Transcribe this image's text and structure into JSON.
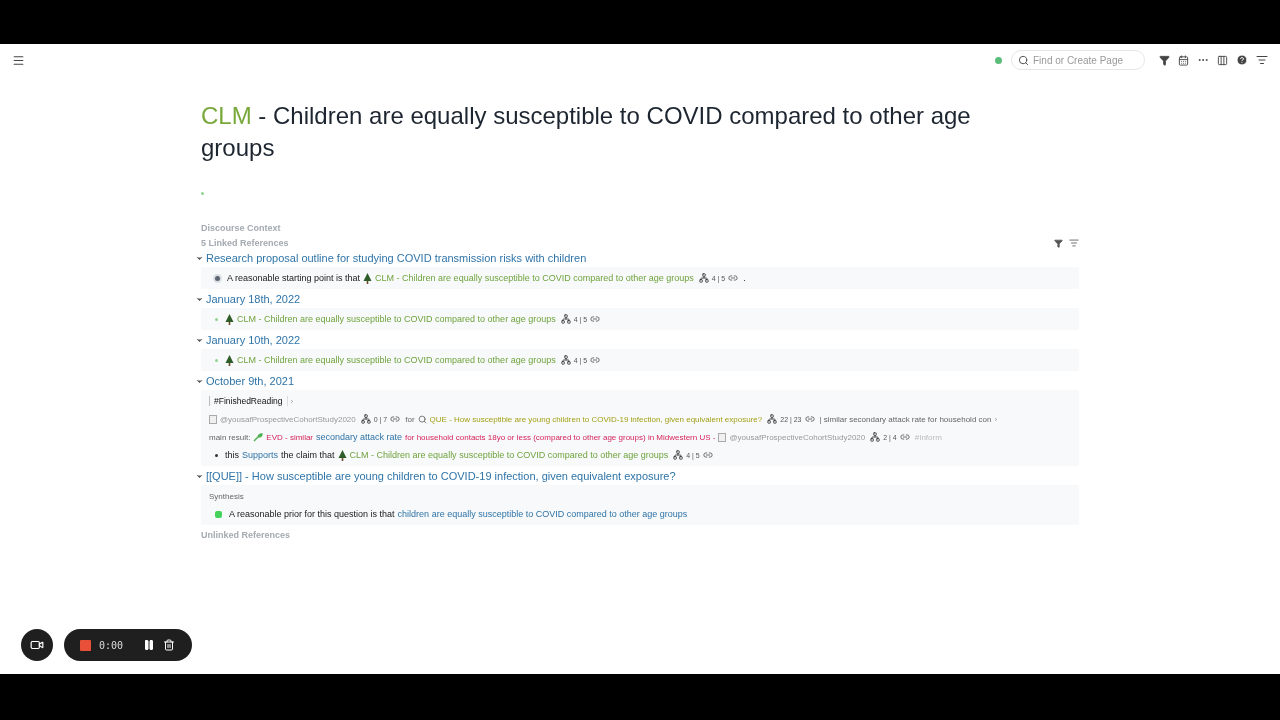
{
  "topbar": {
    "synced": true,
    "search": {
      "placeholder": "Find or Create Page"
    }
  },
  "title": {
    "prefix": "CLM",
    "rest": " - Children are equally susceptible to COVID compared to other age groups"
  },
  "discourse_context": "Discourse Context",
  "linked_references": {
    "label": "5 Linked References",
    "groups": [
      {
        "title": "Research proposal outline for studying COVID transmission risks with children",
        "expanded": true,
        "blocks": [
          {
            "kind": "ring",
            "parts": [
              {
                "kind": "text",
                "text": "A reasonable starting point is that"
              },
              {
                "kind": "claim",
                "text": "CLM - Children are equally susceptible to COVID compared to other age groups"
              },
              {
                "kind": "counts",
                "text": "4 | 5"
              },
              {
                "kind": "text",
                "text": "."
              }
            ]
          }
        ]
      },
      {
        "title": "January 18th, 2022",
        "expanded": true,
        "blocks": [
          {
            "kind": "dot",
            "parts": [
              {
                "kind": "claim",
                "text": "CLM - Children are equally susceptible to COVID compared to other age groups"
              },
              {
                "kind": "counts",
                "text": "4 | 5"
              }
            ]
          }
        ]
      },
      {
        "title": "January 10th, 2022",
        "expanded": true,
        "blocks": [
          {
            "kind": "dot",
            "parts": [
              {
                "kind": "claim",
                "text": "CLM - Children are equally susceptible to COVID compared to other age groups"
              },
              {
                "kind": "counts",
                "text": "4 | 5"
              }
            ]
          }
        ]
      },
      {
        "title": "October 9th, 2021",
        "expanded": true,
        "blocks": [
          {
            "kind": "none",
            "parts": [
              {
                "kind": "tag",
                "text": "#FinishedReading"
              },
              {
                "kind": "chevron",
                "text": "›"
              }
            ]
          },
          {
            "kind": "none",
            "parts": [
              {
                "kind": "source",
                "text": "@yousafProspectiveCohortStudy2020"
              },
              {
                "kind": "counts",
                "text": "0 | 7"
              },
              {
                "kind": "muted",
                "text": "for"
              },
              {
                "kind": "question",
                "text": "QUE - How susceptible are young children to COVID-19 infection, given equivalent exposure?"
              },
              {
                "kind": "counts",
                "text": "22 | 23"
              },
              {
                "kind": "muted",
                "text": "| similar secondary attack rate for household con"
              },
              {
                "kind": "chevron",
                "text": "›"
              }
            ]
          },
          {
            "kind": "none",
            "parts": [
              {
                "kind": "muted",
                "text": "main result:"
              },
              {
                "kind": "evidence",
                "text": "EVD - similar"
              },
              {
                "kind": "page",
                "text": "secondary attack rate"
              },
              {
                "kind": "evidence-cont",
                "text": "for household contacts 18yo or less (compared to other age groups) in Midwestern US -"
              },
              {
                "kind": "source",
                "text": "@yousafProspectiveCohortStudy2020"
              },
              {
                "kind": "counts",
                "text": "2 | 4"
              },
              {
                "kind": "faint",
                "text": "#Inform"
              }
            ]
          },
          {
            "kind": "dot-dark",
            "parts": [
              {
                "kind": "text",
                "text": "this"
              },
              {
                "kind": "page",
                "text": "Supports"
              },
              {
                "kind": "text",
                "text": "the claim that"
              },
              {
                "kind": "claim",
                "text": "CLM - Children are equally susceptible to COVID compared to other age groups"
              },
              {
                "kind": "counts",
                "text": "4 | 5"
              }
            ]
          }
        ]
      },
      {
        "title": "[[QUE]] - How susceptible are young children to COVID-19 infection, given equivalent exposure?",
        "expanded": true,
        "blocks": [
          {
            "kind": "none",
            "parts": [
              {
                "kind": "muted",
                "text": "Synthesis"
              }
            ]
          },
          {
            "kind": "square",
            "parts": [
              {
                "kind": "text",
                "text": "A reasonable prior for this question is that"
              },
              {
                "kind": "page",
                "text": "children are equally susceptible to COVID compared to other age groups"
              }
            ]
          }
        ]
      }
    ]
  },
  "unlinked_references": "Unlinked References",
  "recorder": {
    "time": "0:00"
  }
}
